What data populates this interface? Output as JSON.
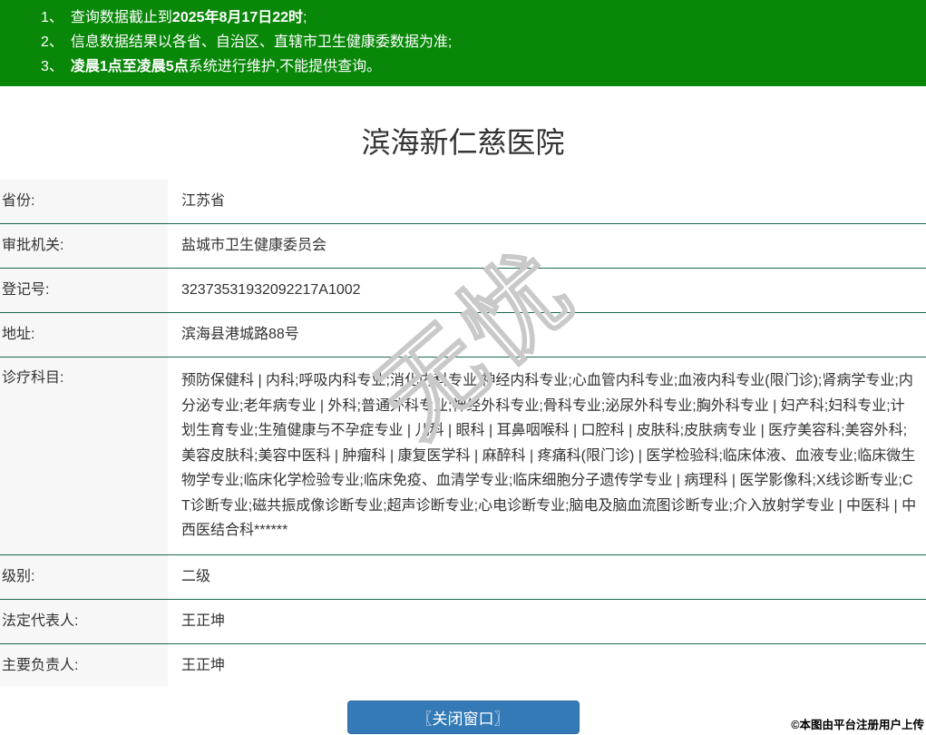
{
  "notices": {
    "items": [
      {
        "num": "1、",
        "prefix": "查询数据截止到",
        "bold": "2025年8月17日22时",
        "suffix": ";"
      },
      {
        "num": "2、",
        "prefix": "信息数据结果以各省、自治区、直辖市卫生健康委数据为准;",
        "bold": "",
        "suffix": ""
      },
      {
        "num": "3、",
        "prefix": "",
        "bold": "凌晨1点至凌晨5点",
        "suffix": "系统进行维护,不能提供查询。"
      }
    ]
  },
  "title": "滨海新仁慈医院",
  "table": {
    "rows": [
      {
        "label": "省份:",
        "value": "江苏省"
      },
      {
        "label": "审批机关:",
        "value": "盐城市卫生健康委员会"
      },
      {
        "label": "登记号:",
        "value": "32373531932092217A1002"
      },
      {
        "label": "地址:",
        "value": "滨海县港城路88号"
      },
      {
        "label": "诊疗科目:",
        "value": "预防保健科 | 内科;呼吸内科专业;消化内科专业;神经内科专业;心血管内科专业;血液内科专业(限门诊);肾病学专业;内分泌专业;老年病专业 | 外科;普通外科专业;神经外科专业;骨科专业;泌尿外科专业;胸外科专业 | 妇产科;妇科专业;计划生育专业;生殖健康与不孕症专业 | 儿科 | 眼科 | 耳鼻咽喉科 | 口腔科 | 皮肤科;皮肤病专业 | 医疗美容科;美容外科;美容皮肤科;美容中医科 | 肿瘤科 | 康复医学科 | 麻醉科 | 疼痛科(限门诊) | 医学检验科;临床体液、血液专业;临床微生物学专业;临床化学检验专业;临床免疫、血清学专业;临床细胞分子遗传学专业 | 病理科 | 医学影像科;X线诊断专业;CT诊断专业;磁共振成像诊断专业;超声诊断专业;心电诊断专业;脑电及脑血流图诊断专业;介入放射学专业 | 中医科 | 中西医结合科******"
      },
      {
        "label": "级别:",
        "value": "二级"
      },
      {
        "label": "法定代表人:",
        "value": "王正坤"
      },
      {
        "label": "主要负责人:",
        "value": "王正坤"
      }
    ]
  },
  "watermark": "无忧",
  "footer": {
    "close_button": "〖关闭窗口〗",
    "copyright": "©本图由平台注册用户上传"
  },
  "colors": {
    "banner_green": "#088708",
    "row_border_green": "#17684b",
    "button_blue": "#337ab7",
    "label_cell_bg": "#f7f7f7"
  }
}
